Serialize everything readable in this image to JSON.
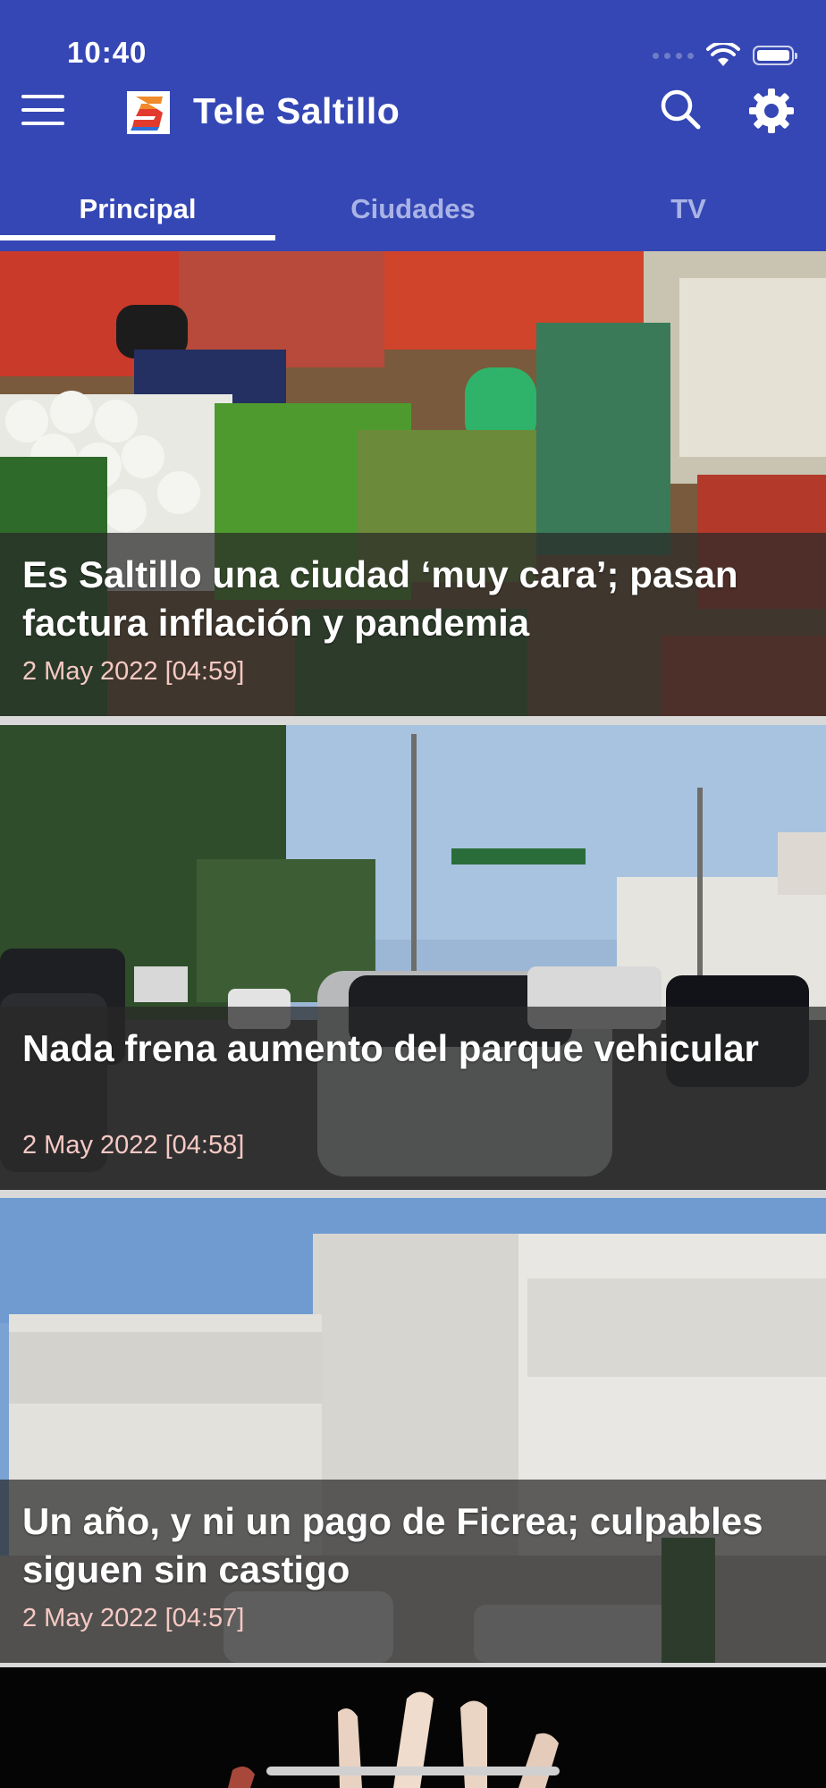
{
  "status_bar": {
    "time": "10:40"
  },
  "header": {
    "app_title": "Tele Saltillo",
    "menu_icon": "hamburger-menu-icon",
    "search_icon": "search-icon",
    "settings_icon": "gear-icon",
    "brand_color": "#3547b4"
  },
  "tabs": [
    {
      "label": "Principal",
      "active": true
    },
    {
      "label": "Ciudades",
      "active": false
    },
    {
      "label": "TV",
      "active": false
    }
  ],
  "articles": [
    {
      "title": "Es Saltillo una ciudad ‘muy cara’; pasan factura inflación y pandemia",
      "date": "2 May 2022 [04:59]"
    },
    {
      "title": "Nada frena aumento del parque vehicular",
      "date": "2 May 2022 [04:58]"
    },
    {
      "title": "Un año, y ni un pago de Ficrea; culpables siguen sin castigo",
      "date": "2 May 2022 [04:57]"
    }
  ],
  "colors": {
    "date_text": "#f6c9c3",
    "inactive_tab": "#a9b3e6"
  }
}
